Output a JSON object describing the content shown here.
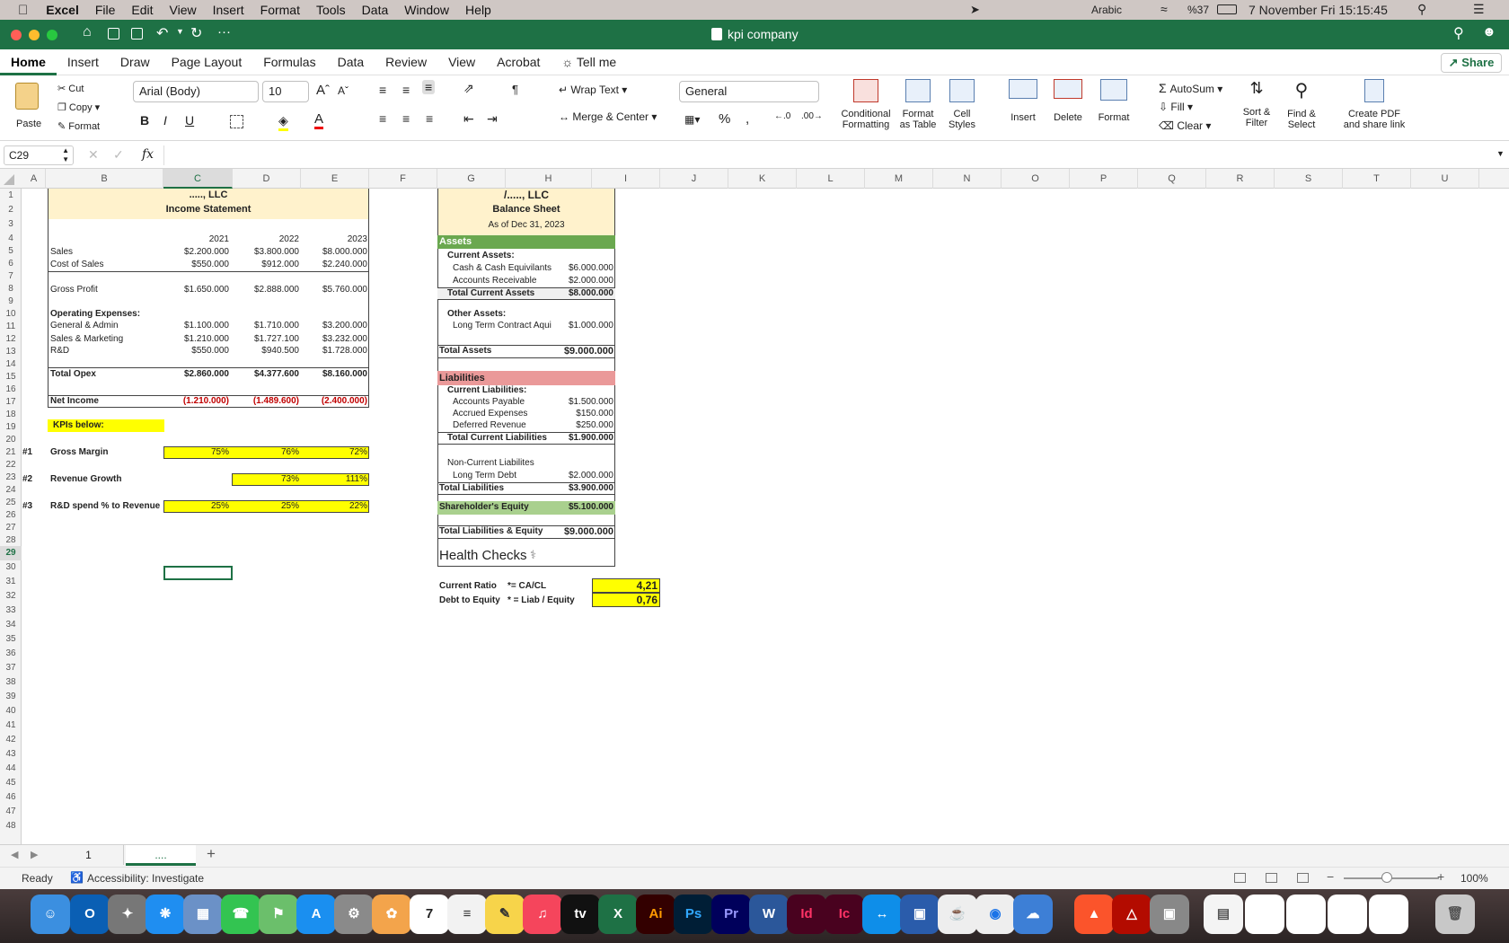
{
  "menubar": {
    "app": "Excel",
    "items": [
      "File",
      "Edit",
      "View",
      "Insert",
      "Format",
      "Tools",
      "Data",
      "Window",
      "Help"
    ],
    "input_source": "Arabic",
    "battery": "%37",
    "datetime": "7 November Fri  15:15:45"
  },
  "window": {
    "title": "kpi company"
  },
  "ribbon_tabs": [
    "Home",
    "Insert",
    "Draw",
    "Page Layout",
    "Formulas",
    "Data",
    "Review",
    "View",
    "Acrobat"
  ],
  "tell_me": "Tell me",
  "share": "Share",
  "ribbon": {
    "paste": "Paste",
    "cut": "Cut",
    "copy": "Copy",
    "format": "Format",
    "font_name": "Arial (Body)",
    "font_size": "10",
    "wrap_text": "Wrap Text",
    "merge_center": "Merge & Center",
    "number_format": "General",
    "cond_format_1": "Conditional",
    "cond_format_2": "Formatting",
    "format_table_1": "Format",
    "format_table_2": "as Table",
    "cell_styles_1": "Cell",
    "cell_styles_2": "Styles",
    "insert": "Insert",
    "delete": "Delete",
    "format_cells": "Format",
    "autosum": "AutoSum",
    "fill": "Fill",
    "clear": "Clear",
    "sort_1": "Sort &",
    "sort_2": "Filter",
    "find_1": "Find &",
    "find_2": "Select",
    "pdf_1": "Create PDF",
    "pdf_2": "and share link"
  },
  "formula_bar": {
    "name_box": "C29",
    "fx": "fx",
    "value": ""
  },
  "columns": [
    "A",
    "B",
    "C",
    "D",
    "E",
    "F",
    "G",
    "H",
    "I",
    "J",
    "K",
    "L",
    "M",
    "N",
    "O",
    "P",
    "Q",
    "R",
    "S",
    "T",
    "U"
  ],
  "rows": [
    "1",
    "2",
    "3",
    "4",
    "5",
    "6",
    "7",
    "8",
    "9",
    "10",
    "11",
    "12",
    "13",
    "14",
    "15",
    "16",
    "17",
    "18",
    "19",
    "20",
    "21",
    "22",
    "23",
    "24",
    "25",
    "26",
    "27",
    "28",
    "29",
    "30",
    "31",
    "32",
    "33",
    "34",
    "35",
    "36",
    "37",
    "38",
    "39",
    "40",
    "41",
    "42",
    "43",
    "44",
    "45",
    "46",
    "47",
    "48"
  ],
  "income": {
    "company": "....., LLC",
    "title": "Income Statement",
    "years": [
      "2021",
      "2022",
      "2023"
    ],
    "sales_label": "Sales",
    "sales": [
      "$2.200.000",
      "$3.800.000",
      "$8.000.000"
    ],
    "cos_label": "Cost of Sales",
    "cos": [
      "$550.000",
      "$912.000",
      "$2.240.000"
    ],
    "gp_label": "Gross Profit",
    "gp": [
      "$1.650.000",
      "$2.888.000",
      "$5.760.000"
    ],
    "opex_label": "Operating Expenses:",
    "ga_label": "General & Admin",
    "ga": [
      "$1.100.000",
      "$1.710.000",
      "$3.200.000"
    ],
    "sm_label": "Sales & Marketing",
    "sm": [
      "$1.210.000",
      "$1.727.100",
      "$3.232.000"
    ],
    "rd_label": "R&D",
    "rd": [
      "$550.000",
      "$940.500",
      "$1.728.000"
    ],
    "topex_label": "Total Opex",
    "topex": [
      "$2.860.000",
      "$4.377.600",
      "$8.160.000"
    ],
    "ni_label": "Net Income",
    "ni": [
      "(1.210.000)",
      "(1.489.600)",
      "(2.400.000)"
    ]
  },
  "kpis": {
    "header": "KPIs below:",
    "k1_num": "#1",
    "k1_label": "Gross Margin",
    "k1": [
      "75%",
      "76%",
      "72%"
    ],
    "k2_num": "#2",
    "k2_label": "Revenue Growth",
    "k2": [
      "73%",
      "111%"
    ],
    "k3_num": "#3",
    "k3_label": "R&D spend % to Revenue",
    "k3": [
      "25%",
      "25%",
      "22%"
    ]
  },
  "balance": {
    "company": "/....., LLC",
    "title": "Balance Sheet",
    "asof": "As of Dec 31, 2023",
    "assets": "Assets",
    "cur_assets": "Current Assets:",
    "cash_label": "Cash & Cash Equivilants",
    "cash": "$6.000.000",
    "ar_label": "Accounts Receivable",
    "ar": "$2.000.000",
    "tca_label": "Total Current Assets",
    "tca": "$8.000.000",
    "other_assets": "Other Assets:",
    "ltc_label": "Long Term Contract Aquistion Cc",
    "ltc": "$1.000.000",
    "ta_label": "Total Assets",
    "ta": "$9.000.000",
    "liabilities": "Liabilities",
    "cur_liab": "Current Liabilities:",
    "ap_label": "Accounts Payable",
    "ap": "$1.500.000",
    "ae_label": "Accrued Expenses",
    "ae": "$150.000",
    "dr_label": "Deferred Revenue",
    "dr": "$250.000",
    "tcl_label": "Total Current Liabilities",
    "tcl": "$1.900.000",
    "ncl_label": "Non-Current Liabilites",
    "ltd_label": "Long Term Debt",
    "ltd": "$2.000.000",
    "tl_label": "Total Liabilities",
    "tl": "$3.900.000",
    "se_label": "Shareholder's Equity",
    "se": "$5.100.000",
    "tle_label": "Total Liabilities & Equity",
    "tle": "$9.000.000"
  },
  "health": {
    "title": "Health Checks",
    "cr_label": "Current Ratio",
    "cr_formula": "*= CA/CL",
    "cr": "4,21",
    "de_label": "Debt to Equity",
    "de_formula": "* = Liab / Equity",
    "de": "0,76"
  },
  "sheet_tabs": [
    "1",
    "...."
  ],
  "status": {
    "ready": "Ready",
    "accessibility": "Accessibility: Investigate",
    "zoom": "100%"
  },
  "colors": {
    "excel_green": "#1e7145",
    "header_fill": "#fff2cc",
    "kpi_yellow": "#ffff00",
    "assets_green": "#6aa84f",
    "liab_red": "#ea9999",
    "equity_green": "#a9d08e"
  }
}
